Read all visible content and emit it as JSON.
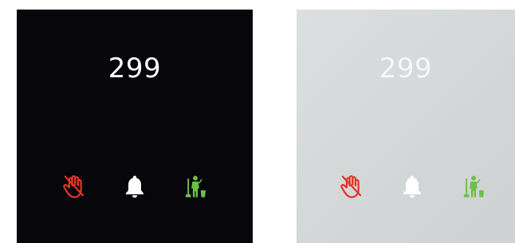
{
  "panels": [
    {
      "theme": "dark",
      "room_number": "299",
      "icons": [
        {
          "name": "do-not-disturb-icon",
          "color": "#e5332a"
        },
        {
          "name": "bell-icon",
          "color": "#ffffff"
        },
        {
          "name": "housekeeping-icon",
          "color": "#6cbf4a"
        }
      ]
    },
    {
      "theme": "light",
      "room_number": "299",
      "icons": [
        {
          "name": "do-not-disturb-icon",
          "color": "#e5332a"
        },
        {
          "name": "bell-icon",
          "color": "#ffffff"
        },
        {
          "name": "housekeeping-icon",
          "color": "#6cbf4a"
        }
      ]
    }
  ]
}
